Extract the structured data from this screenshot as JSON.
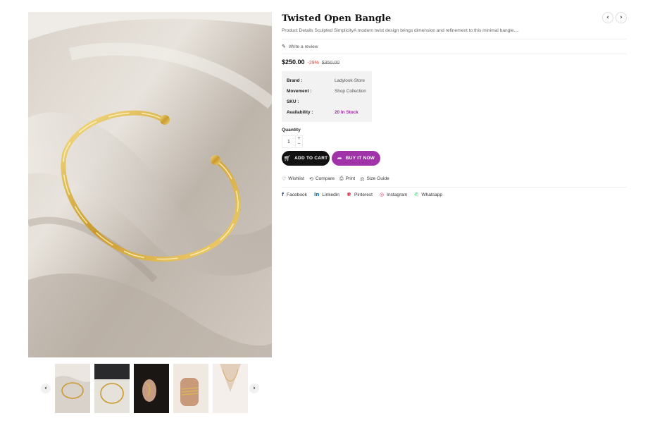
{
  "product": {
    "title": "Twisted Open Bangle",
    "description": "Product Details Sculpted SimplicityA modern twist design brings dimension and refinement to this minimal bangle....",
    "review_link": "Write a review",
    "price": "$250.00",
    "discount": "-29%",
    "compare_price": "$350.00",
    "details": [
      {
        "label": "Brand :",
        "value": "Ladylook-Store"
      },
      {
        "label": "Movement :",
        "value": "Shop Collection"
      },
      {
        "label": "SKU :",
        "value": ""
      },
      {
        "label": "Availability :",
        "value": "20 In Stock"
      }
    ],
    "quantity_label": "Quantity",
    "quantity": "1",
    "add_to_cart": "ADD TO CART",
    "buy_now": "BUY IT NOW"
  },
  "actions": [
    {
      "label": "Wishlist",
      "icon": "heart-icon"
    },
    {
      "label": "Compare",
      "icon": "compare-icon"
    },
    {
      "label": "Print",
      "icon": "print-icon"
    },
    {
      "label": "Size Guide",
      "icon": "ruler-icon"
    }
  ],
  "share": [
    {
      "label": "Facebook",
      "icon": "facebook-icon",
      "color": "#3b5998"
    },
    {
      "label": "Linkedin",
      "icon": "linkedin-icon",
      "color": "#0077b5"
    },
    {
      "label": "Pinterest",
      "icon": "pinterest-icon",
      "color": "#e60023"
    },
    {
      "label": "Instagram",
      "icon": "instagram-icon",
      "color": "#e1306c"
    },
    {
      "label": "Whatsapp",
      "icon": "whatsapp-icon",
      "color": "#25d366"
    }
  ],
  "colors": {
    "accent": "#a033a8",
    "discount": "#e23b3b",
    "stock": "#9a2a9e"
  },
  "gallery": {
    "thumbnail_count": 5
  }
}
